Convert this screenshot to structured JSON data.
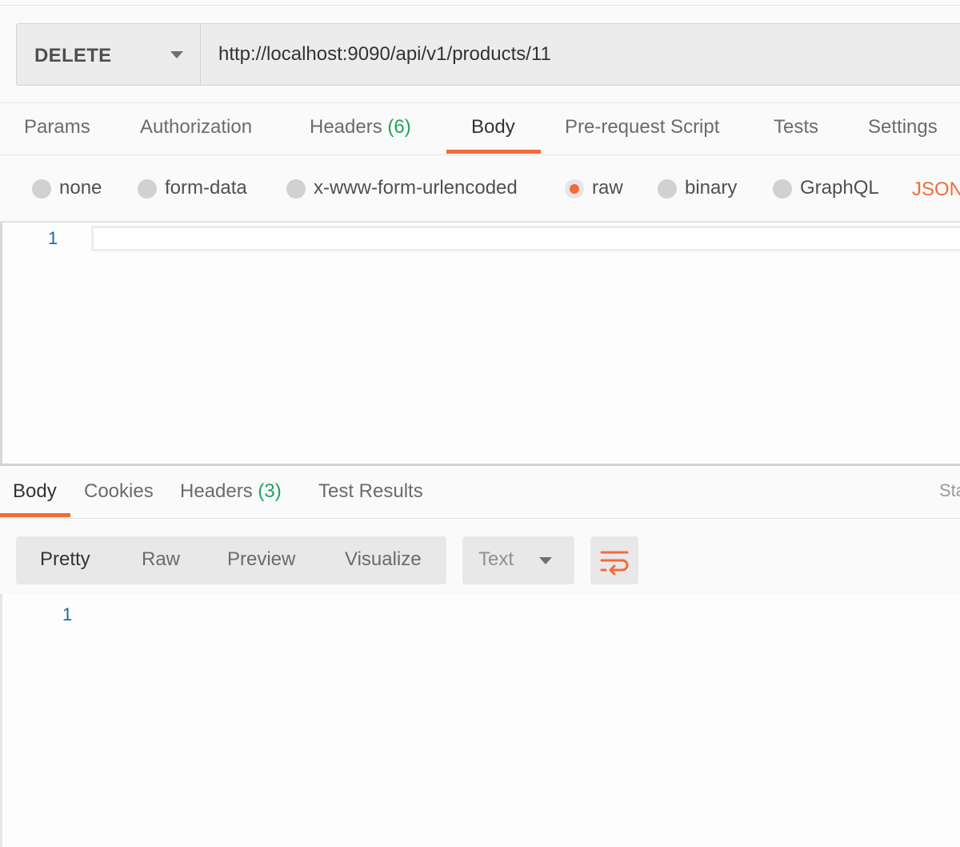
{
  "request": {
    "method": "DELETE",
    "url": "http://localhost:9090/api/v1/products/11"
  },
  "request_tabs": {
    "params": "Params",
    "authorization": "Authorization",
    "headers": "Headers",
    "headers_count": "(6)",
    "body": "Body",
    "pre_request": "Pre-request Script",
    "tests": "Tests",
    "settings": "Settings"
  },
  "body_types": {
    "none": "none",
    "form_data": "form-data",
    "urlencoded": "x-www-form-urlencoded",
    "raw": "raw",
    "binary": "binary",
    "graphql": "GraphQL",
    "json": "JSON",
    "selected": "raw"
  },
  "editor": {
    "line_number": "1"
  },
  "response_tabs": {
    "body": "Body",
    "cookies": "Cookies",
    "headers": "Headers",
    "headers_count": "(3)",
    "test_results": "Test Results",
    "status_partial": "Sta"
  },
  "response_view": {
    "pretty": "Pretty",
    "raw": "Raw",
    "preview": "Preview",
    "visualize": "Visualize",
    "format": "Text"
  },
  "response_body": {
    "line_number": "1"
  },
  "colors": {
    "accent": "#f26b3a",
    "count": "#20a361",
    "line_number": "#1c6a9a"
  }
}
